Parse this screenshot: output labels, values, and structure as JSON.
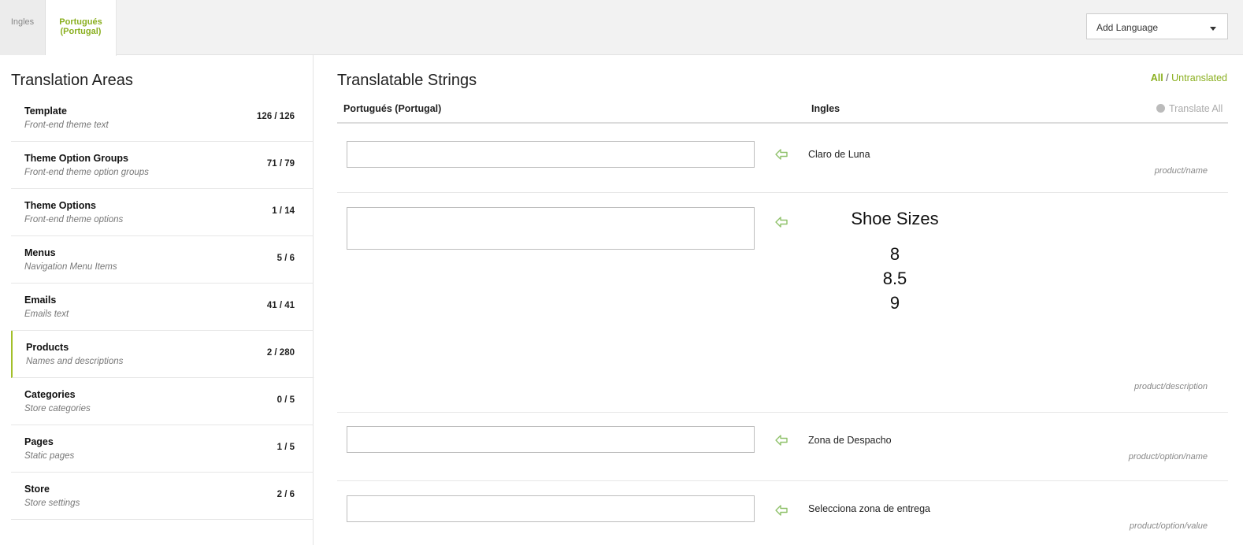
{
  "tabs": [
    {
      "label": "Ingles"
    },
    {
      "label": "Portugués (Portugal)"
    }
  ],
  "add_language": {
    "label": "Add Language"
  },
  "sidebar": {
    "title": "Translation Areas",
    "areas": [
      {
        "name": "Template",
        "desc": "Front-end theme text",
        "count": "126 / 126"
      },
      {
        "name": "Theme Option Groups",
        "desc": "Front-end theme option groups",
        "count": "71 / 79"
      },
      {
        "name": "Theme Options",
        "desc": "Front-end theme options",
        "count": "1 / 14"
      },
      {
        "name": "Menus",
        "desc": "Navigation Menu Items",
        "count": "5 / 6"
      },
      {
        "name": "Emails",
        "desc": "Emails text",
        "count": "41 / 41"
      },
      {
        "name": "Products",
        "desc": "Names and descriptions",
        "count": "2 / 280"
      },
      {
        "name": "Categories",
        "desc": "Store categories",
        "count": "0 / 5"
      },
      {
        "name": "Pages",
        "desc": "Static pages",
        "count": "1 / 5"
      },
      {
        "name": "Store",
        "desc": "Store settings",
        "count": "2 / 6"
      }
    ],
    "active_area": "Products"
  },
  "main": {
    "title": "Translatable Strings",
    "filter_all": "All",
    "filter_sep": "/",
    "filter_untranslated": "Untranslated",
    "col_target": "Portugués (Portugal)",
    "col_source": "Ingles",
    "translate_all": "Translate All",
    "strings": [
      {
        "value": "",
        "source": "Claro de Luna",
        "path": "product/name"
      },
      {
        "value": "",
        "source_title": "Shoe Sizes",
        "source_items": [
          "8",
          "8.5",
          "9"
        ],
        "path": "product/description"
      },
      {
        "value": "",
        "source": "Zona de Despacho",
        "path": "product/option/name"
      },
      {
        "value": "",
        "source": "Selecciona zona de entrega",
        "path": "product/option/value"
      }
    ]
  },
  "colors": {
    "accent": "#8aaf1f",
    "active_border": "#a3c02a",
    "arrow": "#8fc16a"
  }
}
